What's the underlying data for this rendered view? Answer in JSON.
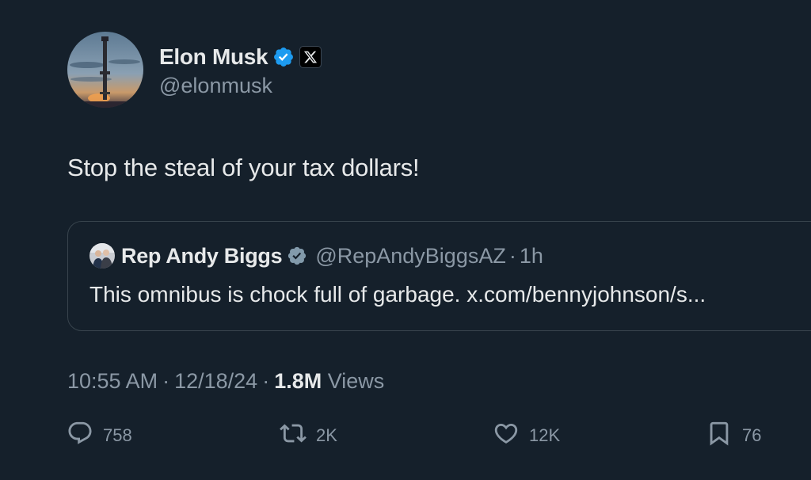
{
  "author": {
    "display_name": "Elon Musk",
    "handle": "@elonmusk",
    "verified": true,
    "affiliation_icon": "x-logo-icon"
  },
  "tweet": {
    "text": "Stop the steal of your tax dollars!"
  },
  "quoted_tweet": {
    "display_name": "Rep Andy Biggs",
    "handle": "@RepAndyBiggsAZ",
    "separator": "·",
    "time": "1h",
    "verified": true,
    "text": "This omnibus is chock full of garbage. x.com/bennyjohnson/s..."
  },
  "meta": {
    "time": "10:55 AM",
    "date": "12/18/24",
    "separator": "·",
    "views_count": "1.8M",
    "views_label": "Views"
  },
  "actions": {
    "replies": "758",
    "reposts": "2K",
    "likes": "12K",
    "bookmarks": "76"
  },
  "colors": {
    "background": "#15202b",
    "text_primary": "#e7e9ea",
    "text_secondary": "#8b98a5",
    "verified_blue": "#1d9bf0",
    "border": "#38444d"
  }
}
